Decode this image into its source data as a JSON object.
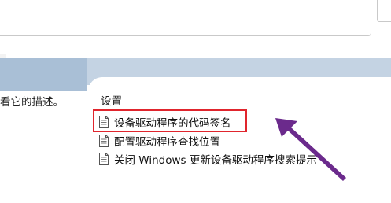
{
  "left_pane": {
    "description_text": "看它的描述。"
  },
  "settings_pane": {
    "header": "设置",
    "items": [
      {
        "label": "设备驱动程序的代码签名",
        "icon": "document-icon",
        "highlighted": true
      },
      {
        "label": "配置驱动程序查找位置",
        "icon": "document-icon",
        "highlighted": false
      },
      {
        "label": "关闭 Windows 更新设备驱动程序搜索提示",
        "icon": "document-icon",
        "highlighted": false
      }
    ]
  },
  "annotation": {
    "highlight_color": "#e0252d",
    "arrow_color": "#6b2a8c",
    "arrow_icon": "arrow-pointer-icon"
  }
}
